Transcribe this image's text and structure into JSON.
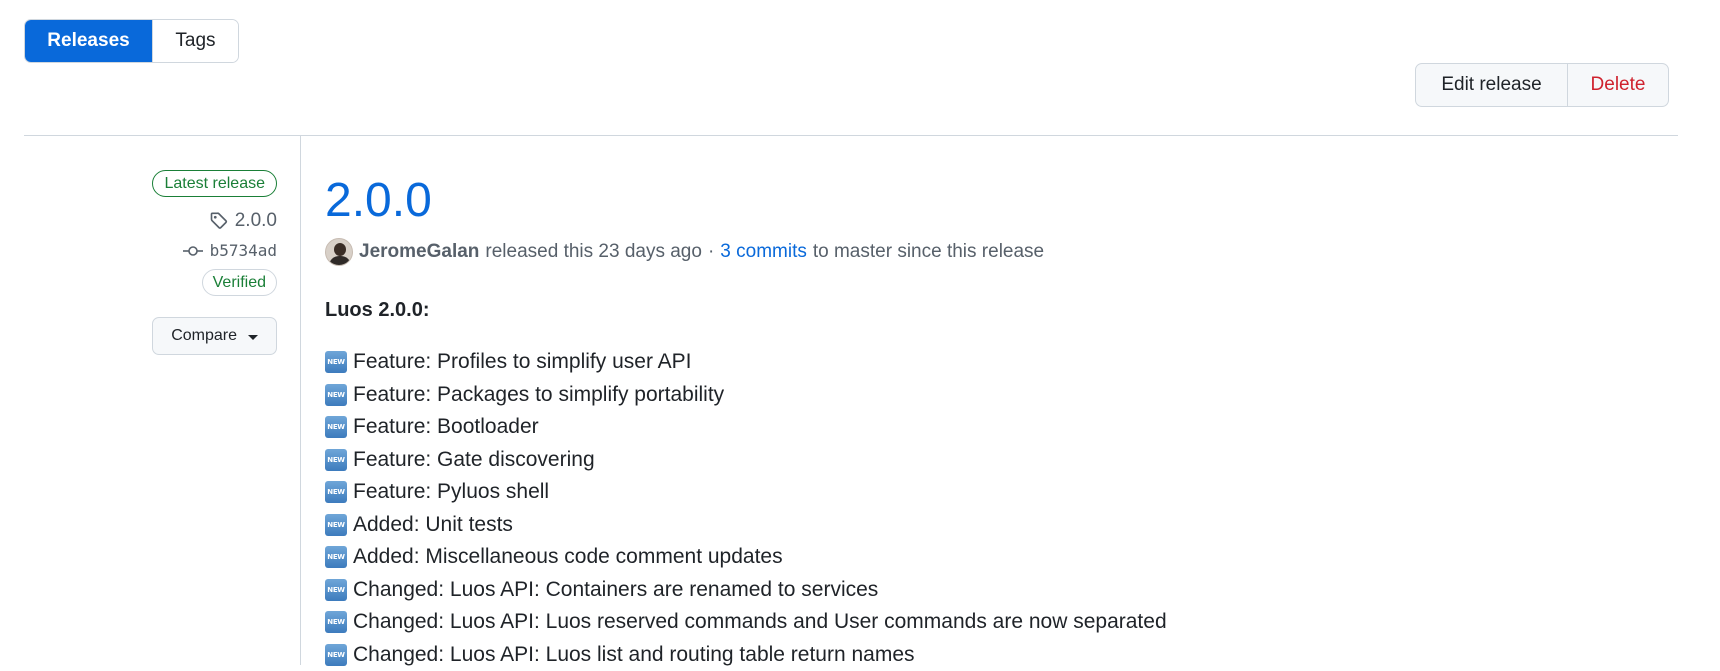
{
  "tabs": {
    "releases": "Releases",
    "tags": "Tags"
  },
  "actions": {
    "edit": "Edit release",
    "delete": "Delete"
  },
  "sidebar": {
    "latest_badge": "Latest release",
    "tag": "2.0.0",
    "commit": "b5734ad",
    "verified": "Verified",
    "compare": "Compare"
  },
  "release": {
    "title": "2.0.0",
    "author": "JeromeGalan",
    "released_text": "released this 23 days ago",
    "separator": "·",
    "commits_link": "3 commits",
    "commits_suffix": "to master since this release",
    "section_title": "Luos 2.0.0:",
    "new_icon_text": "NEW",
    "notes": [
      "Feature: Profiles to simplify user API",
      "Feature: Packages to simplify portability",
      "Feature: Bootloader",
      "Feature: Gate discovering",
      "Feature: Pyluos shell",
      "Added: Unit tests",
      "Added: Miscellaneous code comment updates",
      "Changed: Luos API: Containers are renamed to services",
      "Changed: Luos API: Luos reserved commands and User commands are now separated",
      "Changed: Luos API: Luos list and routing table return names"
    ]
  },
  "colors": {
    "accent": "#0969da",
    "danger": "#cf222e",
    "success": "#1a7f37",
    "border": "#d0d7de"
  }
}
